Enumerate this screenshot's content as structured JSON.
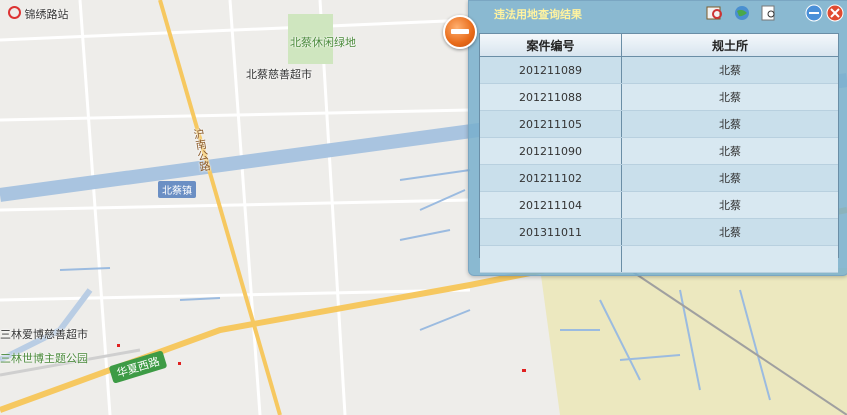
{
  "map": {
    "top_left_label": "锦绣路站",
    "park_label": "北蔡休闲绿地",
    "poi_label": "北蔡慈善超市",
    "road_vertical": "沪南公路",
    "town_badge": "北蔡镇",
    "poi2_label": "三林爱博慈善超市",
    "park2_label": "三林世博主题公园",
    "road_bottom": "华夏西路"
  },
  "panel": {
    "title": "违法用地查询结果",
    "columns": [
      "案件编号",
      "规土所"
    ],
    "rows": [
      [
        "201211089",
        "北蔡"
      ],
      [
        "201211088",
        "北蔡"
      ],
      [
        "201211105",
        "北蔡"
      ],
      [
        "201211090",
        "北蔡"
      ],
      [
        "201211102",
        "北蔡"
      ],
      [
        "201211104",
        "北蔡"
      ],
      [
        "201311011",
        "北蔡"
      ]
    ]
  },
  "icons": [
    "export-icon",
    "globe-icon",
    "print-icon",
    "minimize-icon",
    "close-icon",
    "collapse-icon"
  ]
}
